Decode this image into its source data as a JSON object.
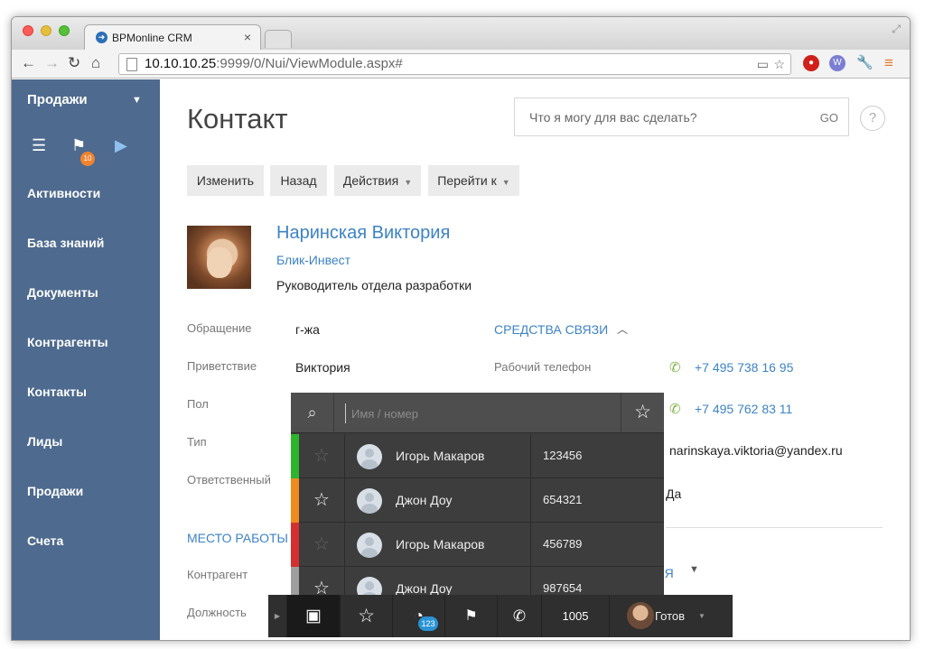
{
  "browser": {
    "tab_title": "BPMonline CRM",
    "tab_close": "×",
    "url_host": "10.10.10.25",
    "url_path": ":9999/0/Nui/ViewModule.aspx#"
  },
  "sidebar": {
    "section": "Продажи",
    "badge": "10",
    "items": [
      "Активности",
      "База знаний",
      "Документы",
      "Контрагенты",
      "Контакты",
      "Лиды",
      "Продажи",
      "Счета"
    ]
  },
  "page": {
    "title": "Контакт",
    "search_placeholder": "Что я могу для вас сделать?",
    "search_go": "GO",
    "help": "?",
    "actions": {
      "edit": "Изменить",
      "back": "Назад",
      "actions": "Действия",
      "goto": "Перейти к"
    }
  },
  "contact": {
    "name": "Наринская Виктория",
    "company": "Блик-Инвест",
    "job": "Руководитель отдела разработки"
  },
  "fields": [
    {
      "label": "Обращение",
      "value": "г-жа"
    },
    {
      "label": "Приветствие",
      "value": "Виктория"
    },
    {
      "label": "Пол",
      "value": ""
    },
    {
      "label": "Тип",
      "value": ""
    },
    {
      "label": "Ответственный",
      "value": ""
    }
  ],
  "communications": {
    "header": "СРЕДСТВА СВЯЗИ",
    "work_phone_label": "Рабочий телефон",
    "phone1": "+7 495 738 16 95",
    "phone2": "+7 495 762 83 11",
    "email": "narinskaya.viktoria@yandex.ru",
    "yes": "Да",
    "collapsed_section": "ТИЯ"
  },
  "work": {
    "header": "МЕСТО РАБОТЫ",
    "account_label": "Контрагент",
    "position_label": "Должность"
  },
  "phone_panel": {
    "search_placeholder": "Имя / номер",
    "rows": [
      {
        "name": "Игорь Макаров",
        "number": "123456",
        "color": "#2db52d",
        "favorite": false
      },
      {
        "name": "Джон Доу",
        "number": "654321",
        "color": "#f08a1c",
        "favorite": true
      },
      {
        "name": "Игорь Макаров",
        "number": "456789",
        "color": "#d3302f",
        "favorite": false
      },
      {
        "name": "Джон Доу",
        "number": "987654",
        "color": "#9e9e9e",
        "favorite": true
      }
    ]
  },
  "phone_bar": {
    "history_count": "123",
    "extension": "1005",
    "status": "Готов"
  },
  "colors": {
    "sidebar": "#4e6a8f",
    "accent": "#3d83c4",
    "panel": "#3d3d3d"
  }
}
